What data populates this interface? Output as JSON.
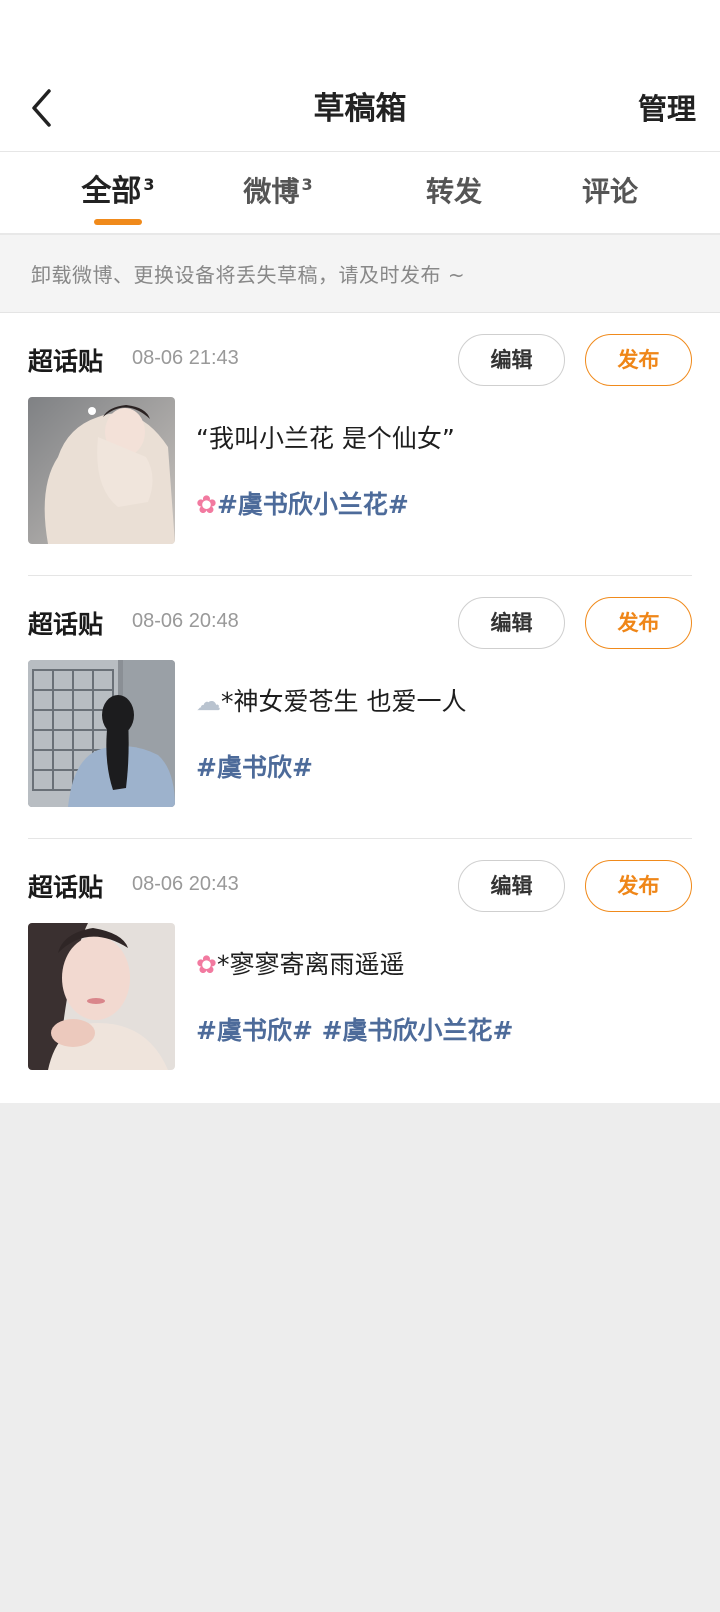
{
  "nav": {
    "title": "草稿箱",
    "manage_label": "管理"
  },
  "tabs": [
    {
      "label": "全部",
      "count": "3",
      "active": true
    },
    {
      "label": "微博",
      "count": "3",
      "active": false
    },
    {
      "label": "转发",
      "count": "",
      "active": false
    },
    {
      "label": "评论",
      "count": "",
      "active": false
    }
  ],
  "notice": "卸载微博、更换设备将丢失草稿，请及时发布 ~",
  "colors": {
    "accent": "#f08a1b",
    "topic_link": "#4d6b9a"
  },
  "drafts": [
    {
      "type": "超话贴",
      "time": "08-06 21:43",
      "edit_label": "编辑",
      "publish_label": "发布",
      "line1_icon": "",
      "line1": "“我叫小兰花 是个仙女”",
      "line2_icon": "cherry-blossom-icon",
      "line2": "#虞书欣小兰花#"
    },
    {
      "type": "超话贴",
      "time": "08-06 20:48",
      "edit_label": "编辑",
      "publish_label": "发布",
      "line1_icon": "cloud-icon",
      "line1": "*神女爱苍生 也爱一人",
      "line2_icon": "",
      "line2": "#虞书欣#"
    },
    {
      "type": "超话贴",
      "time": "08-06 20:43",
      "edit_label": "编辑",
      "publish_label": "发布",
      "line1_icon": "cherry-blossom-icon",
      "line1": "*寥寥寄离雨遥遥",
      "line2_icon": "",
      "line2": "#虞书欣# #虞书欣小兰花#"
    }
  ]
}
